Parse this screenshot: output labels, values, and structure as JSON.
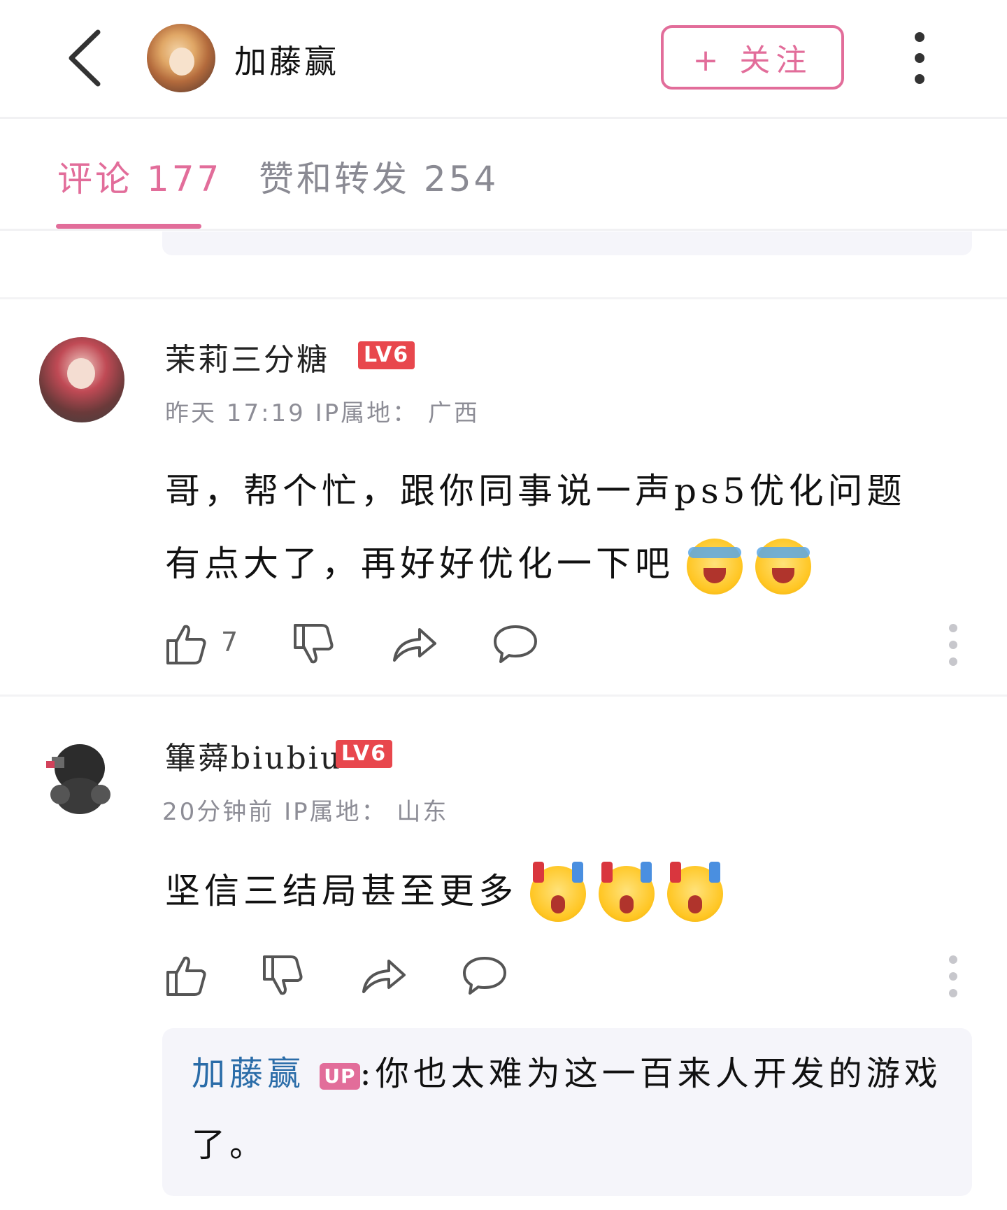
{
  "header": {
    "author_name": "加藤赢",
    "follow_label": "+ 关注",
    "icons": [
      "chevron-left-icon",
      "more-vertical-icon"
    ]
  },
  "tabs": [
    {
      "label": "评论 177",
      "active": true
    },
    {
      "label": "赞和转发 254",
      "active": false
    }
  ],
  "colors": {
    "accent": "#e26d9a",
    "level": "#e8474d",
    "reply_name": "#2a6ca8"
  },
  "comments": [
    {
      "name": "茉莉三分糖",
      "level": "LV6",
      "meta": "昨天 17:19 IP属地： 广西",
      "text_line1": "哥，帮个忙，跟你同事说一声ps5优化问题",
      "text_line2": "有点大了，再好好优化一下吧",
      "like_count": "7"
    },
    {
      "name": "篳蕣biubiu",
      "level": "LV6",
      "meta": "20分钟前 IP属地： 山东",
      "text": "坚信三结局甚至更多",
      "reply": {
        "name": "加藤赢",
        "badge": "UP",
        "text": ":你也太难为这一百来人开发的游戏了。"
      }
    }
  ]
}
